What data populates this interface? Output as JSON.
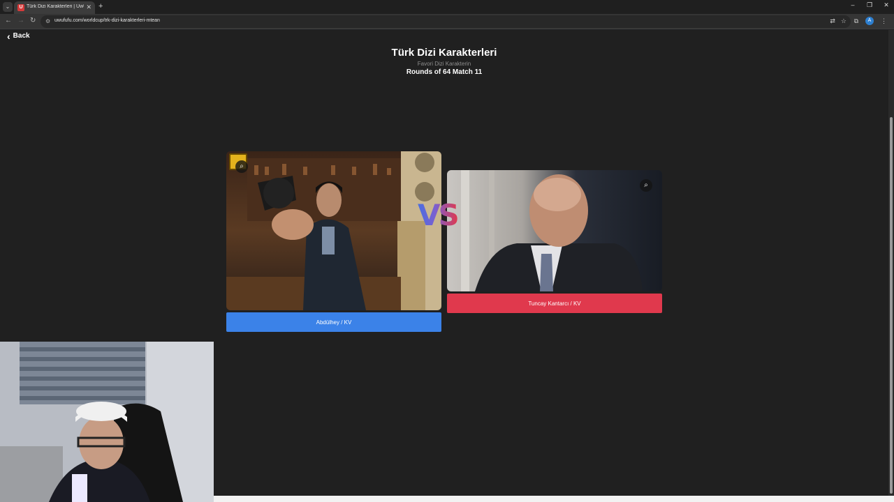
{
  "browser": {
    "tab_title": "Türk Dizi Karakterleri | UwUFUFU",
    "tab_favicon": "U",
    "url": "uwufufu.com/worldcup/trk-dizi-karakterleri-mtean",
    "profile_initial": "A"
  },
  "page": {
    "back_label": "Back",
    "title": "Türk Dizi Karakterleri",
    "subtitle": "Favori Dizi Karakterin",
    "round_label": "Rounds of 64 Match 11",
    "vs_text": "VS"
  },
  "contestants": [
    {
      "name": "Abdülhey / KV",
      "color": "#3b82e8"
    },
    {
      "name": "Tuncay Kantarcı / KV",
      "color": "#e0394d"
    }
  ],
  "icons": {
    "back": "chevron-left-icon",
    "zoom": "zoom-in-icon",
    "badge": "badge-icon"
  }
}
